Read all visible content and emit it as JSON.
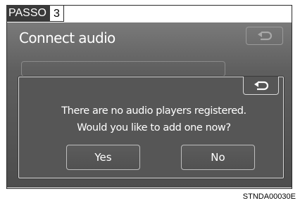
{
  "step": {
    "word": "PASSO",
    "number": "3"
  },
  "screen": {
    "title": "Connect audio",
    "back_icon": "return-arrow-icon"
  },
  "dialog": {
    "message_line1": "There are no audio players registered.",
    "message_line2": "Would you like to add one now?",
    "yes_label": "Yes",
    "no_label": "No",
    "back_icon": "return-arrow-icon"
  },
  "caption": "STNDA00030E",
  "colors": {
    "screen_background": "#5e5e5e",
    "dialog_background": "#565656",
    "text": "#ffffff",
    "tag_background": "#3a3a3a"
  }
}
